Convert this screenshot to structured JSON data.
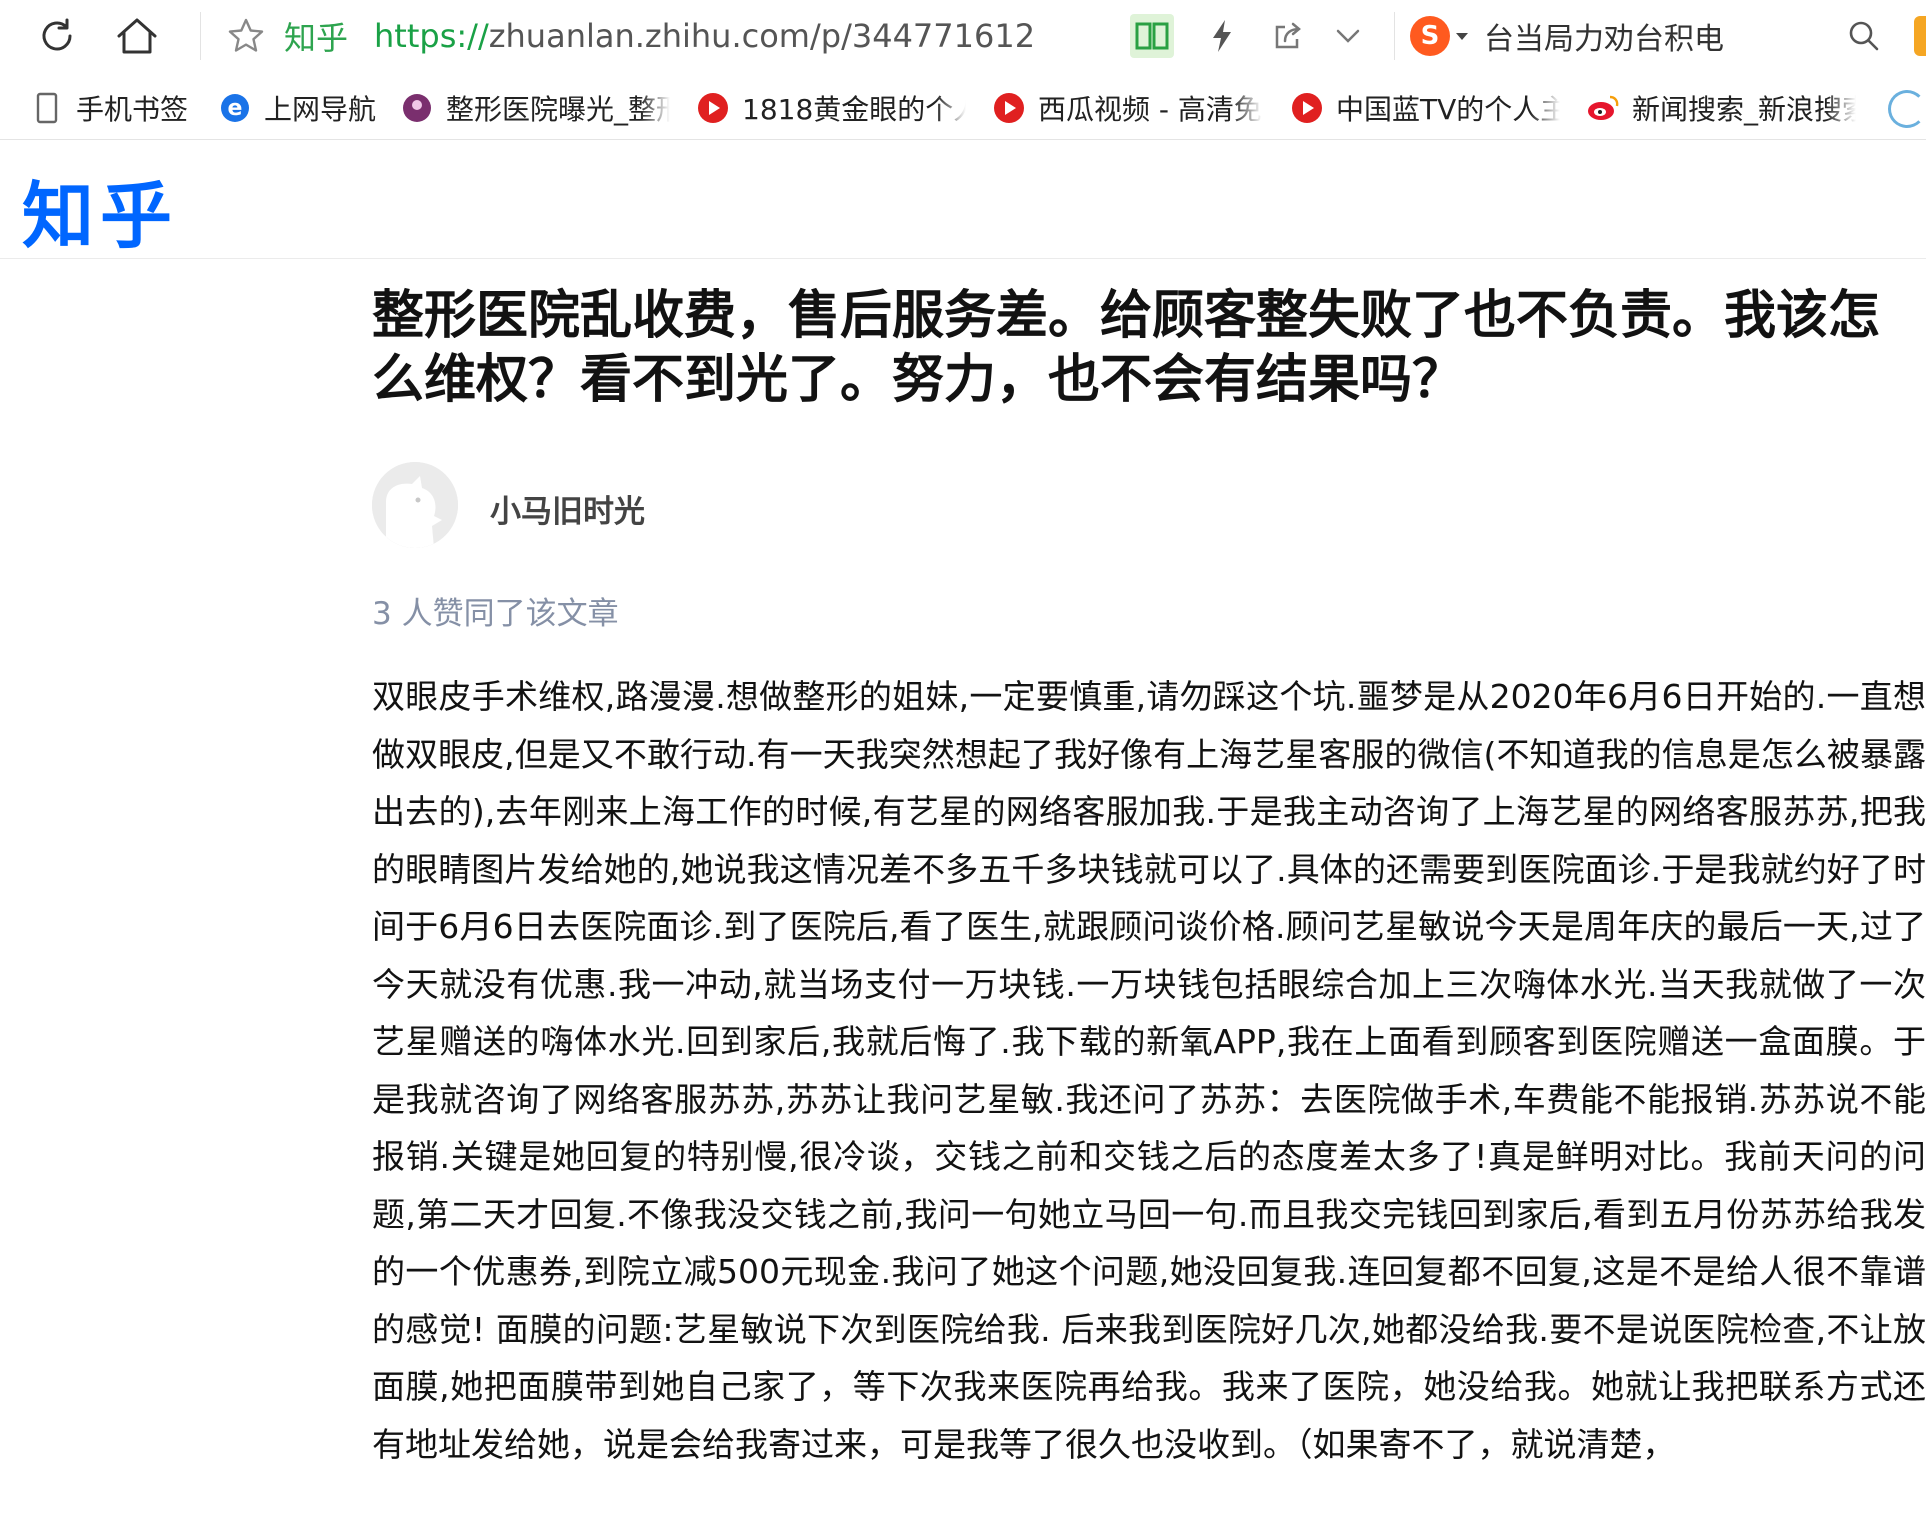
{
  "address_bar": {
    "site_name": "知乎",
    "url_scheme": "https://",
    "url_rest": "zhuanlan.zhihu.com/p/344771612",
    "search_text": "台当局力劝台积电"
  },
  "bookmarks": [
    {
      "label": "手机书签",
      "icon": "phone-icon"
    },
    {
      "label": "上网导航",
      "icon": "ie-icon"
    },
    {
      "label": "整形医院曝光_整形",
      "icon": "site-logo-icon"
    },
    {
      "label": "1818黄金眼的个人",
      "icon": "play-icon"
    },
    {
      "label": "西瓜视频 - 高清免",
      "icon": "play-icon"
    },
    {
      "label": "中国蓝TV的个人主",
      "icon": "play-icon"
    },
    {
      "label": "新闻搜索_新浪搜索",
      "icon": "weibo-icon"
    }
  ],
  "header": {
    "logo_text": "知乎"
  },
  "article": {
    "title": "整形医院乱收费，售后服务差。给顾客整失败了也不负责。我该怎么维权？看不到光了。努力，也不会有结果吗？",
    "author": "小马旧时光",
    "vote_text": "3 人赞同了该文章",
    "body": "双眼皮手术维权,路漫漫.想做整形的姐妹,一定要慎重,请勿踩这个坑.噩梦是从2020年6月6日开始的.一直想做双眼皮,但是又不敢行动.有一天我突然想起了我好像有上海艺星客服的微信(不知道我的信息是怎么被暴露出去的),去年刚来上海工作的时候,有艺星的网络客服加我.于是我主动咨询了上海艺星的网络客服苏苏,把我的眼睛图片发给她的,她说我这情况差不多五千多块钱就可以了.具体的还需要到医院面诊.于是我就约好了时间于6月6日去医院面诊.到了医院后,看了医生,就跟顾问谈价格.顾问艺星敏说今天是周年庆的最后一天,过了今天就没有优惠.我一冲动,就当场支付一万块钱.一万块钱包括眼综合加上三次嗨体水光.当天我就做了一次艺星赠送的嗨体水光.回到家后,我就后悔了.我下载的新氧APP,我在上面看到顾客到医院赠送一盒面膜。于是我就咨询了网络客服苏苏,苏苏让我问艺星敏.我还问了苏苏：去医院做手术,车费能不能报销.苏苏说不能报销.关键是她回复的特别慢,很冷谈，交钱之前和交钱之后的态度差太多了!真是鲜明对比。我前天问的问题,第二天才回复.不像我没交钱之前,我问一句她立马回一句.而且我交完钱回到家后,看到五月份苏苏给我发的一个优惠券,到院立减500元现金.我问了她这个问题,她没回复我.连回复都不回复,这是不是给人很不靠谱的感觉! 面膜的问题:艺星敏说下次到医院给我. 后来我到医院好几次,她都没给我.要不是说医院检查,不让放面膜,她把面膜带到她自己家了，等下次我来医院再给我。我来了医院，她没给我。她就让我把联系方式还有地址发给她，说是会给我寄过来，可是我等了很久也没收到。（如果寄不了，就说清楚，"
  }
}
